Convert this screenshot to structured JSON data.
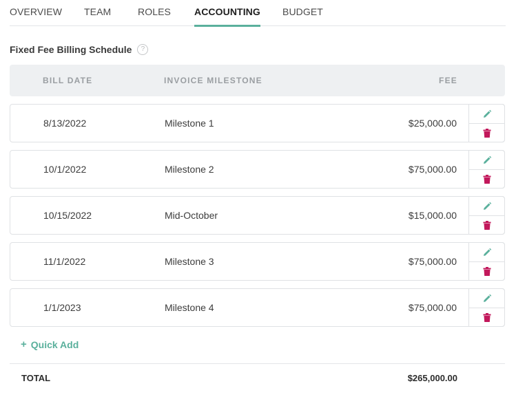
{
  "tabs": [
    {
      "label": "OVERVIEW",
      "active": false
    },
    {
      "label": "TEAM",
      "active": false
    },
    {
      "label": "ROLES",
      "active": false
    },
    {
      "label": "ACCOUNTING",
      "active": true
    },
    {
      "label": "BUDGET",
      "active": false
    }
  ],
  "section": {
    "title": "Fixed Fee Billing Schedule",
    "help_icon_glyph": "?"
  },
  "table": {
    "headers": {
      "bill_date": "BILL DATE",
      "invoice_milestone": "INVOICE MILESTONE",
      "fee": "FEE"
    },
    "rows": [
      {
        "date": "8/13/2022",
        "milestone": "Milestone 1",
        "fee": "$25,000.00"
      },
      {
        "date": "10/1/2022",
        "milestone": "Milestone 2",
        "fee": "$75,000.00"
      },
      {
        "date": "10/15/2022",
        "milestone": "Mid-October",
        "fee": "$15,000.00"
      },
      {
        "date": "11/1/2022",
        "milestone": "Milestone 3",
        "fee": "$75,000.00"
      },
      {
        "date": "1/1/2023",
        "milestone": "Milestone 4",
        "fee": "$75,000.00"
      }
    ]
  },
  "quick_add": {
    "plus": "+",
    "label": "Quick Add"
  },
  "total": {
    "label": "TOTAL",
    "value": "$265,000.00"
  },
  "icons": {
    "edit": "pencil-icon",
    "delete": "trash-icon",
    "help": "question-circle-icon"
  },
  "colors": {
    "accent": "#5ab09c",
    "delete": "#c2185b",
    "header_bg": "#eef0f2"
  }
}
